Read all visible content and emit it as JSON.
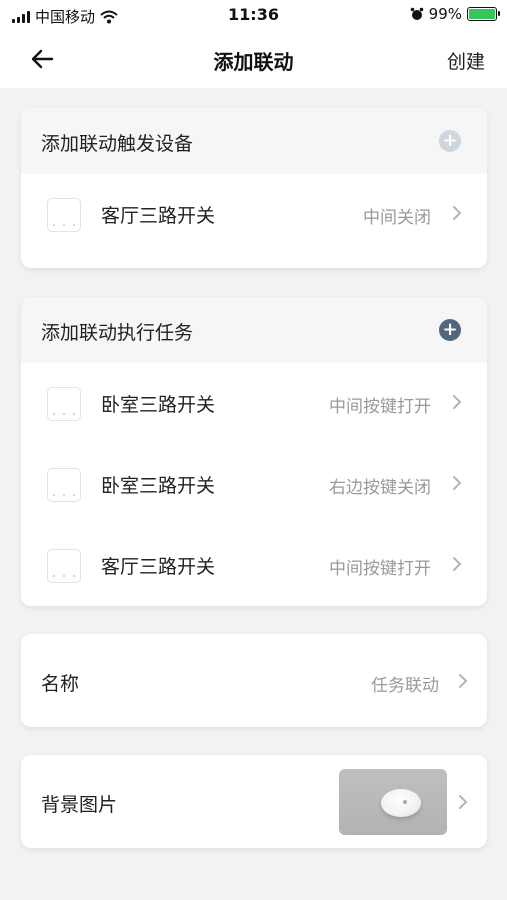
{
  "status_bar": {
    "carrier": "中国移动",
    "time": "11:36",
    "battery_percent": "99%",
    "battery_level": 0.99
  },
  "nav": {
    "title": "添加联动",
    "action": "创建",
    "back_icon": "back-arrow-icon"
  },
  "trigger": {
    "header": "添加联动触发设备",
    "plus_color": "#d0d6dd",
    "items": [
      {
        "name": "客厅三路开关",
        "status": "中间关闭"
      }
    ]
  },
  "tasks": {
    "header": "添加联动执行任务",
    "plus_color": "#51677c",
    "items": [
      {
        "name": "卧室三路开关",
        "status": "中间按键打开"
      },
      {
        "name": "卧室三路开关",
        "status": "右边按键关闭"
      },
      {
        "name": "客厅三路开关",
        "status": "中间按键打开"
      }
    ]
  },
  "name_row": {
    "label": "名称",
    "value": "任务联动"
  },
  "background_row": {
    "label": "背景图片",
    "thumbnail": "round-white-device-photo"
  }
}
